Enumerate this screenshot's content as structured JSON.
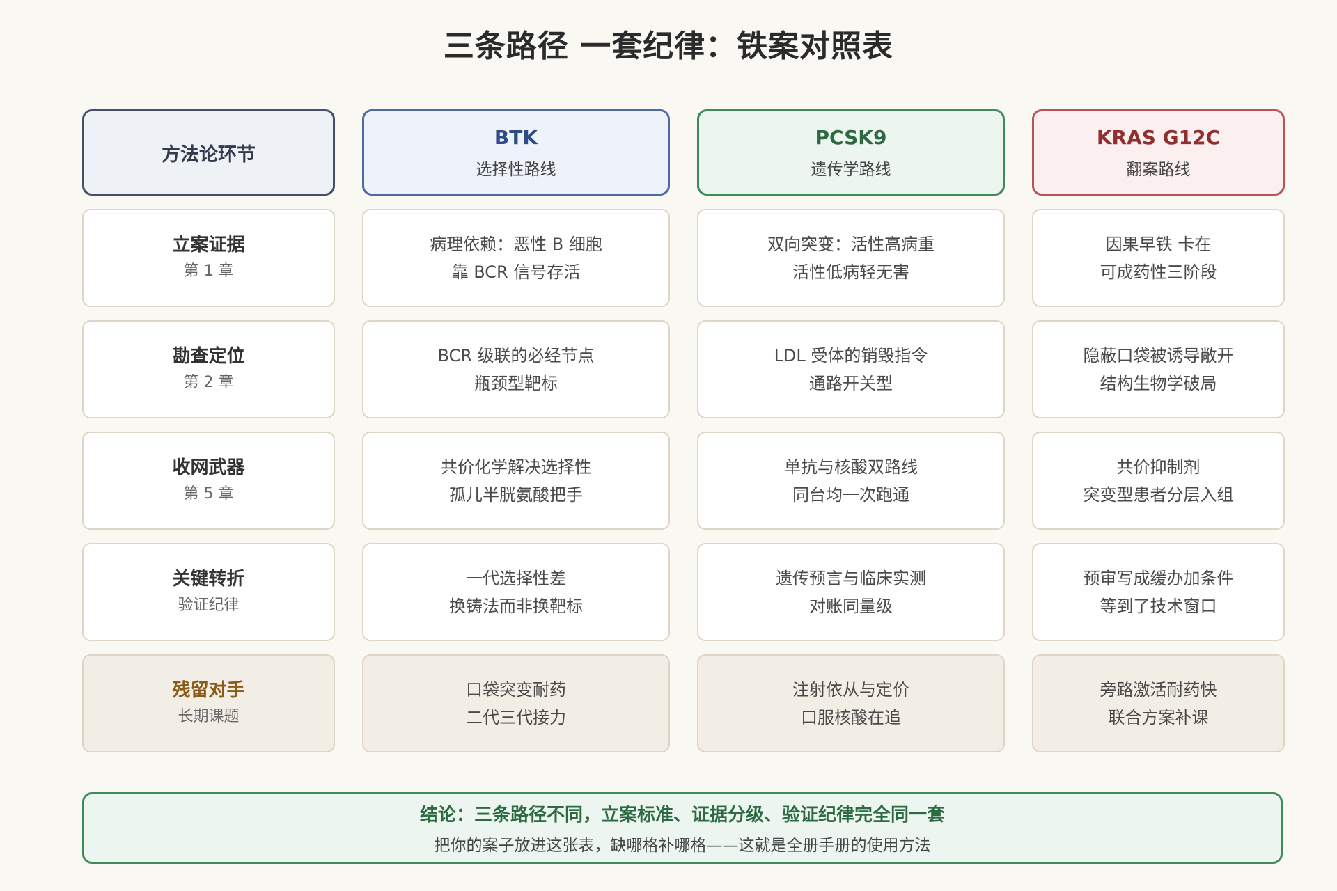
{
  "title": "三条路径 一套纪律：铁案对照表",
  "headers": [
    {
      "title": "方法论环节",
      "sub": ""
    },
    {
      "title": "BTK",
      "sub": "选择性路线"
    },
    {
      "title": "PCSK9",
      "sub": "遗传学路线"
    },
    {
      "title": "KRAS G12C",
      "sub": "翻案路线"
    }
  ],
  "rows": [
    {
      "label": "立案证据",
      "label_sub": "第 1 章",
      "cells": [
        [
          "病理依赖：恶性 B 细胞",
          "靠 BCR 信号存活"
        ],
        [
          "双向突变：活性高病重",
          "活性低病轻无害"
        ],
        [
          "因果早铁 卡在",
          "可成药性三阶段"
        ]
      ]
    },
    {
      "label": "勘查定位",
      "label_sub": "第 2 章",
      "cells": [
        [
          "BCR 级联的必经节点",
          "瓶颈型靶标"
        ],
        [
          "LDL 受体的销毁指令",
          "通路开关型"
        ],
        [
          "隐蔽口袋被诱导敞开",
          "结构生物学破局"
        ]
      ]
    },
    {
      "label": "收网武器",
      "label_sub": "第 5 章",
      "cells": [
        [
          "共价化学解决选择性",
          "孤儿半胱氨酸把手"
        ],
        [
          "单抗与核酸双路线",
          "同台均一次跑通"
        ],
        [
          "共价抑制剂",
          "突变型患者分层入组"
        ]
      ]
    },
    {
      "label": "关键转折",
      "label_sub": "验证纪律",
      "cells": [
        [
          "一代选择性差",
          "换铸法而非换靶标"
        ],
        [
          "遗传预言与临床实测",
          "对账同量级"
        ],
        [
          "预审写成缓办加条件",
          "等到了技术窗口"
        ]
      ]
    },
    {
      "label": "残留对手",
      "label_sub": "长期课题",
      "cells": [
        [
          "口袋突变耐药",
          "二代三代接力"
        ],
        [
          "注射依从与定价",
          "口服核酸在追"
        ],
        [
          "旁路激活耐药快",
          "联合方案补课"
        ]
      ]
    }
  ],
  "conclusion": {
    "line1": "结论：三条路径不同，立案标准、证据分级、验证纪律完全同一套",
    "line2": "把你的案子放进这张表，缺哪格补哪格——这就是全册手册的使用方法"
  }
}
